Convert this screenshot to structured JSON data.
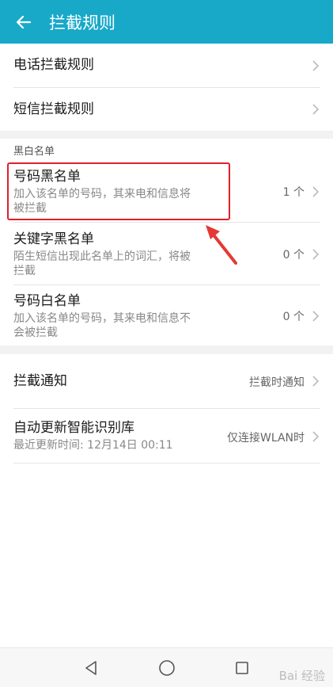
{
  "appbar": {
    "title": "拦截规则"
  },
  "rules": {
    "call": "电话拦截规则",
    "sms": "短信拦截规则"
  },
  "lists_section": {
    "title": "黑白名单",
    "items": [
      {
        "label": "号码黑名单",
        "sub1": "加入该名单的号码，其来电和信息将",
        "sub2": "被拦截",
        "value": "1 个"
      },
      {
        "label": "关键字黑名单",
        "sub1": "陌生短信出现此名单上的词汇，将被",
        "sub2": "拦截",
        "value": "0 个"
      },
      {
        "label": "号码白名单",
        "sub1": "加入该名单的号码，其来电和信息不",
        "sub2": "会被拦截",
        "value": "0 个"
      }
    ]
  },
  "notify": {
    "label": "拦截通知",
    "value": "拦截时通知"
  },
  "update": {
    "label": "自动更新智能识别库",
    "sub": "最近更新时间: 12月14日 00:11",
    "value": "仅连接WLAN时"
  },
  "navbar": {
    "back": "back-triangle",
    "home": "home-circle",
    "recents": "recents-square"
  },
  "watermark": "Bai 经验",
  "colors": {
    "appbar": "#18a9c9",
    "highlight": "#e0202a",
    "arrow": "#e53935"
  }
}
